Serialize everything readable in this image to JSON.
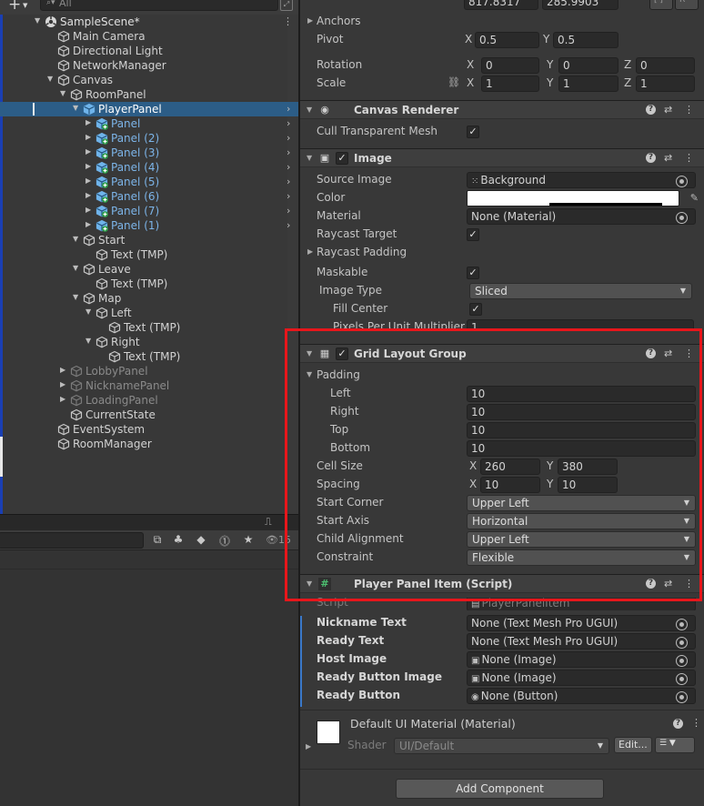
{
  "hierarchy": {
    "search_placeholder": "All",
    "items": [
      {
        "label": "SampleScene*",
        "depth": 0,
        "expanded": true,
        "icon": "unity-scene-icon",
        "style": "scene"
      },
      {
        "label": "Main Camera",
        "depth": 1,
        "icon": "cube-icon"
      },
      {
        "label": "Directional Light",
        "depth": 1,
        "icon": "cube-icon"
      },
      {
        "label": "NetworkManager",
        "depth": 1,
        "icon": "cube-icon"
      },
      {
        "label": "Canvas",
        "depth": 1,
        "expanded": true,
        "icon": "cube-icon"
      },
      {
        "label": "RoomPanel",
        "depth": 2,
        "expanded": true,
        "icon": "cube-icon"
      },
      {
        "label": "PlayerPanel",
        "depth": 3,
        "expanded": true,
        "icon": "prefab-cube-icon",
        "selected": true
      },
      {
        "label": "Panel",
        "depth": 4,
        "collapsed": true,
        "icon": "prefab-add-icon",
        "style": "prefab",
        "chevron": true
      },
      {
        "label": "Panel (2)",
        "depth": 4,
        "collapsed": true,
        "icon": "prefab-add-icon",
        "style": "prefab",
        "chevron": true
      },
      {
        "label": "Panel (3)",
        "depth": 4,
        "collapsed": true,
        "icon": "prefab-add-icon",
        "style": "prefab",
        "chevron": true
      },
      {
        "label": "Panel (4)",
        "depth": 4,
        "collapsed": true,
        "icon": "prefab-add-icon",
        "style": "prefab",
        "chevron": true
      },
      {
        "label": "Panel (5)",
        "depth": 4,
        "collapsed": true,
        "icon": "prefab-add-icon",
        "style": "prefab",
        "chevron": true
      },
      {
        "label": "Panel (6)",
        "depth": 4,
        "collapsed": true,
        "icon": "prefab-add-icon",
        "style": "prefab",
        "chevron": true
      },
      {
        "label": "Panel (7)",
        "depth": 4,
        "collapsed": true,
        "icon": "prefab-add-icon",
        "style": "prefab",
        "chevron": true
      },
      {
        "label": "Panel (1)",
        "depth": 4,
        "collapsed": true,
        "icon": "prefab-add-icon",
        "style": "prefab",
        "chevron": true
      },
      {
        "label": "Start",
        "depth": 3,
        "expanded": true,
        "icon": "cube-icon"
      },
      {
        "label": "Text (TMP)",
        "depth": 4,
        "icon": "cube-icon"
      },
      {
        "label": "Leave",
        "depth": 3,
        "expanded": true,
        "icon": "cube-icon"
      },
      {
        "label": "Text (TMP)",
        "depth": 4,
        "icon": "cube-icon"
      },
      {
        "label": "Map",
        "depth": 3,
        "expanded": true,
        "icon": "cube-icon"
      },
      {
        "label": "Left",
        "depth": 4,
        "expanded": true,
        "icon": "cube-icon"
      },
      {
        "label": "Text (TMP)",
        "depth": 5,
        "icon": "cube-icon"
      },
      {
        "label": "Right",
        "depth": 4,
        "expanded": true,
        "icon": "cube-icon"
      },
      {
        "label": "Text (TMP)",
        "depth": 5,
        "icon": "cube-icon"
      },
      {
        "label": "LobbyPanel",
        "depth": 2,
        "collapsed": true,
        "icon": "cube-icon",
        "style": "inactive"
      },
      {
        "label": "NicknamePanel",
        "depth": 2,
        "collapsed": true,
        "icon": "cube-icon",
        "style": "inactive"
      },
      {
        "label": "LoadingPanel",
        "depth": 2,
        "collapsed": true,
        "icon": "cube-icon",
        "style": "inactive"
      },
      {
        "label": "CurrentState",
        "depth": 2,
        "icon": "cube-icon"
      },
      {
        "label": "EventSystem",
        "depth": 1,
        "icon": "cube-icon"
      },
      {
        "label": "RoomManager",
        "depth": 1,
        "icon": "cube-icon"
      }
    ]
  },
  "project": {
    "visible_count": "15"
  },
  "inspector": {
    "rect_transform": {
      "size_x": "817.8317",
      "size_y": "285.9903",
      "anchors_label": "Anchors",
      "pivot_label": "Pivot",
      "pivot_x": "0.5",
      "pivot_y": "0.5",
      "rotation_label": "Rotation",
      "rotation_x": "0",
      "rotation_y": "0",
      "rotation_z": "0",
      "scale_label": "Scale",
      "scale_x": "1",
      "scale_y": "1",
      "scale_z": "1",
      "top_btn_1": "[ ]",
      "top_btn_2": "R"
    },
    "canvas_renderer": {
      "title": "Canvas Renderer",
      "cull_label": "Cull Transparent Mesh"
    },
    "image": {
      "title": "Image",
      "source_image_label": "Source Image",
      "source_image_value": "Background",
      "color_label": "Color",
      "material_label": "Material",
      "material_value": "None (Material)",
      "raycast_target_label": "Raycast Target",
      "raycast_padding_label": "Raycast Padding",
      "maskable_label": "Maskable",
      "image_type_label": "Image Type",
      "image_type_value": "Sliced",
      "fill_center_label": "Fill Center",
      "ppu_label": "Pixels Per Unit Multiplier",
      "ppu_value": "1"
    },
    "grid_layout": {
      "title": "Grid Layout Group",
      "padding_label": "Padding",
      "left_label": "Left",
      "left_value": "10",
      "right_label": "Right",
      "right_value": "10",
      "top_label": "Top",
      "top_value": "10",
      "bottom_label": "Bottom",
      "bottom_value": "10",
      "cell_size_label": "Cell Size",
      "cell_x": "260",
      "cell_y": "380",
      "spacing_label": "Spacing",
      "spacing_x": "10",
      "spacing_y": "10",
      "start_corner_label": "Start Corner",
      "start_corner_value": "Upper Left",
      "start_axis_label": "Start Axis",
      "start_axis_value": "Horizontal",
      "child_alignment_label": "Child Alignment",
      "child_alignment_value": "Upper Left",
      "constraint_label": "Constraint",
      "constraint_value": "Flexible"
    },
    "player_panel_item": {
      "title": "Player Panel Item (Script)",
      "script_label": "Script",
      "script_value": "PlayerPanelItem",
      "nickname_label": "Nickname Text",
      "nickname_value": "None (Text Mesh Pro UGUI)",
      "ready_text_label": "Ready Text",
      "ready_text_value": "None (Text Mesh Pro UGUI)",
      "host_image_label": "Host Image",
      "host_image_value": "None (Image)",
      "ready_button_image_label": "Ready Button Image",
      "ready_button_image_value": "None (Image)",
      "ready_button_label": "Ready Button",
      "ready_button_value": "None (Button)"
    },
    "material": {
      "title": "Default UI Material (Material)",
      "shader_label": "Shader",
      "shader_value": "UI/Default",
      "edit_label": "Edit..."
    },
    "add_component_label": "Add Component",
    "axis_x": "X",
    "axis_y": "Y",
    "axis_z": "Z"
  },
  "colors": {
    "highlight": "#e8161b",
    "selection": "#2c5d87",
    "prefab_text": "#7cb4e8"
  }
}
